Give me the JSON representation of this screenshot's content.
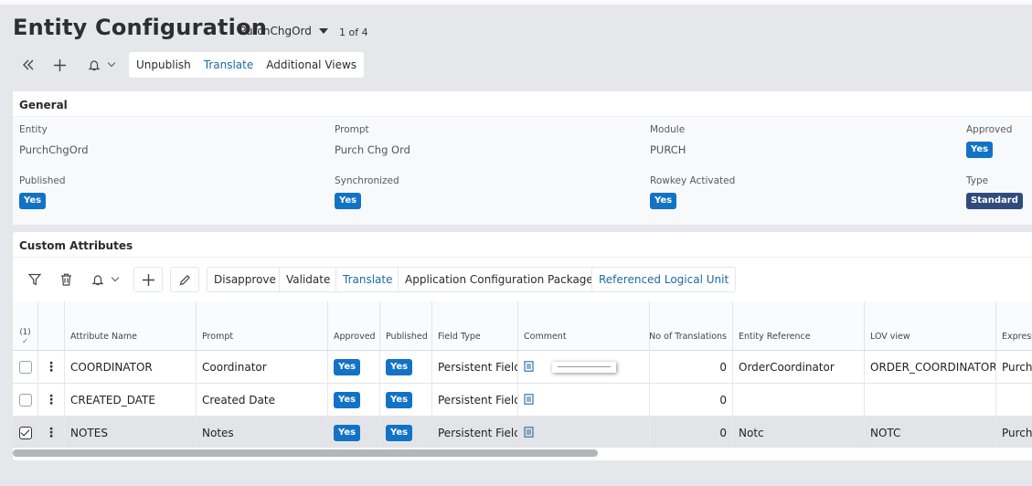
{
  "header": {
    "title": "Entity Configuration",
    "record_selector": "PurchChgOrd",
    "record_count": "1 of 4"
  },
  "toolbar": {
    "unpublish_label": "Unpublish",
    "translate_label": "Translate",
    "additional_views_label": "Additional Views"
  },
  "general": {
    "section_title": "General",
    "fields": {
      "entity": {
        "label": "Entity",
        "value": "PurchChgOrd"
      },
      "prompt": {
        "label": "Prompt",
        "value": "Purch Chg Ord"
      },
      "module": {
        "label": "Module",
        "value": "PURCH"
      },
      "approved": {
        "label": "Approved",
        "value": "Yes"
      },
      "published": {
        "label": "Published",
        "value": "Yes"
      },
      "synchronized": {
        "label": "Synchronized",
        "value": "Yes"
      },
      "rowkey_activated": {
        "label": "Rowkey Activated",
        "value": "Yes"
      },
      "type": {
        "label": "Type",
        "value": "Standard"
      }
    }
  },
  "custom_attributes": {
    "section_title": "Custom Attributes",
    "toolbar": {
      "disapprove_label": "Disapprove",
      "validate_label": "Validate",
      "translate_label": "Translate",
      "app_config_package_label": "Application Configuration Package",
      "referenced_logical_unit_label": "Referenced Logical Unit"
    },
    "selection_count": "(1)",
    "columns": {
      "attribute_name": "Attribute Name",
      "prompt": "Prompt",
      "approved": "Approved",
      "published": "Published",
      "field_type": "Field Type",
      "comment": "Comment",
      "no_of_translations": "No of Translations",
      "entity_reference": "Entity Reference",
      "lov_view": "LOV view",
      "expression": "Express"
    },
    "rows": [
      {
        "attribute_name": "COORDINATOR",
        "prompt": "Coordinator",
        "approved": "Yes",
        "published": "Yes",
        "field_type": "Persistent Field",
        "no_of_translations": "0",
        "entity_reference": "OrderCoordinator",
        "lov_view": "ORDER_COORDINATOR...",
        "expression": "Purch_"
      },
      {
        "attribute_name": "CREATED_DATE",
        "prompt": "Created Date",
        "approved": "Yes",
        "published": "Yes",
        "field_type": "Persistent Field",
        "no_of_translations": "0",
        "entity_reference": "",
        "lov_view": "",
        "expression": ""
      },
      {
        "attribute_name": "NOTES",
        "prompt": "Notes",
        "approved": "Yes",
        "published": "Yes",
        "field_type": "Persistent Field",
        "no_of_translations": "0",
        "entity_reference": "Notc",
        "lov_view": "NOTC",
        "expression": "Purch_"
      }
    ]
  },
  "colors": {
    "badge_blue": "#1273c6",
    "badge_dark": "#2f4c7c",
    "link_blue": "#1b6aa8",
    "page_bg": "#e6e7ea"
  }
}
